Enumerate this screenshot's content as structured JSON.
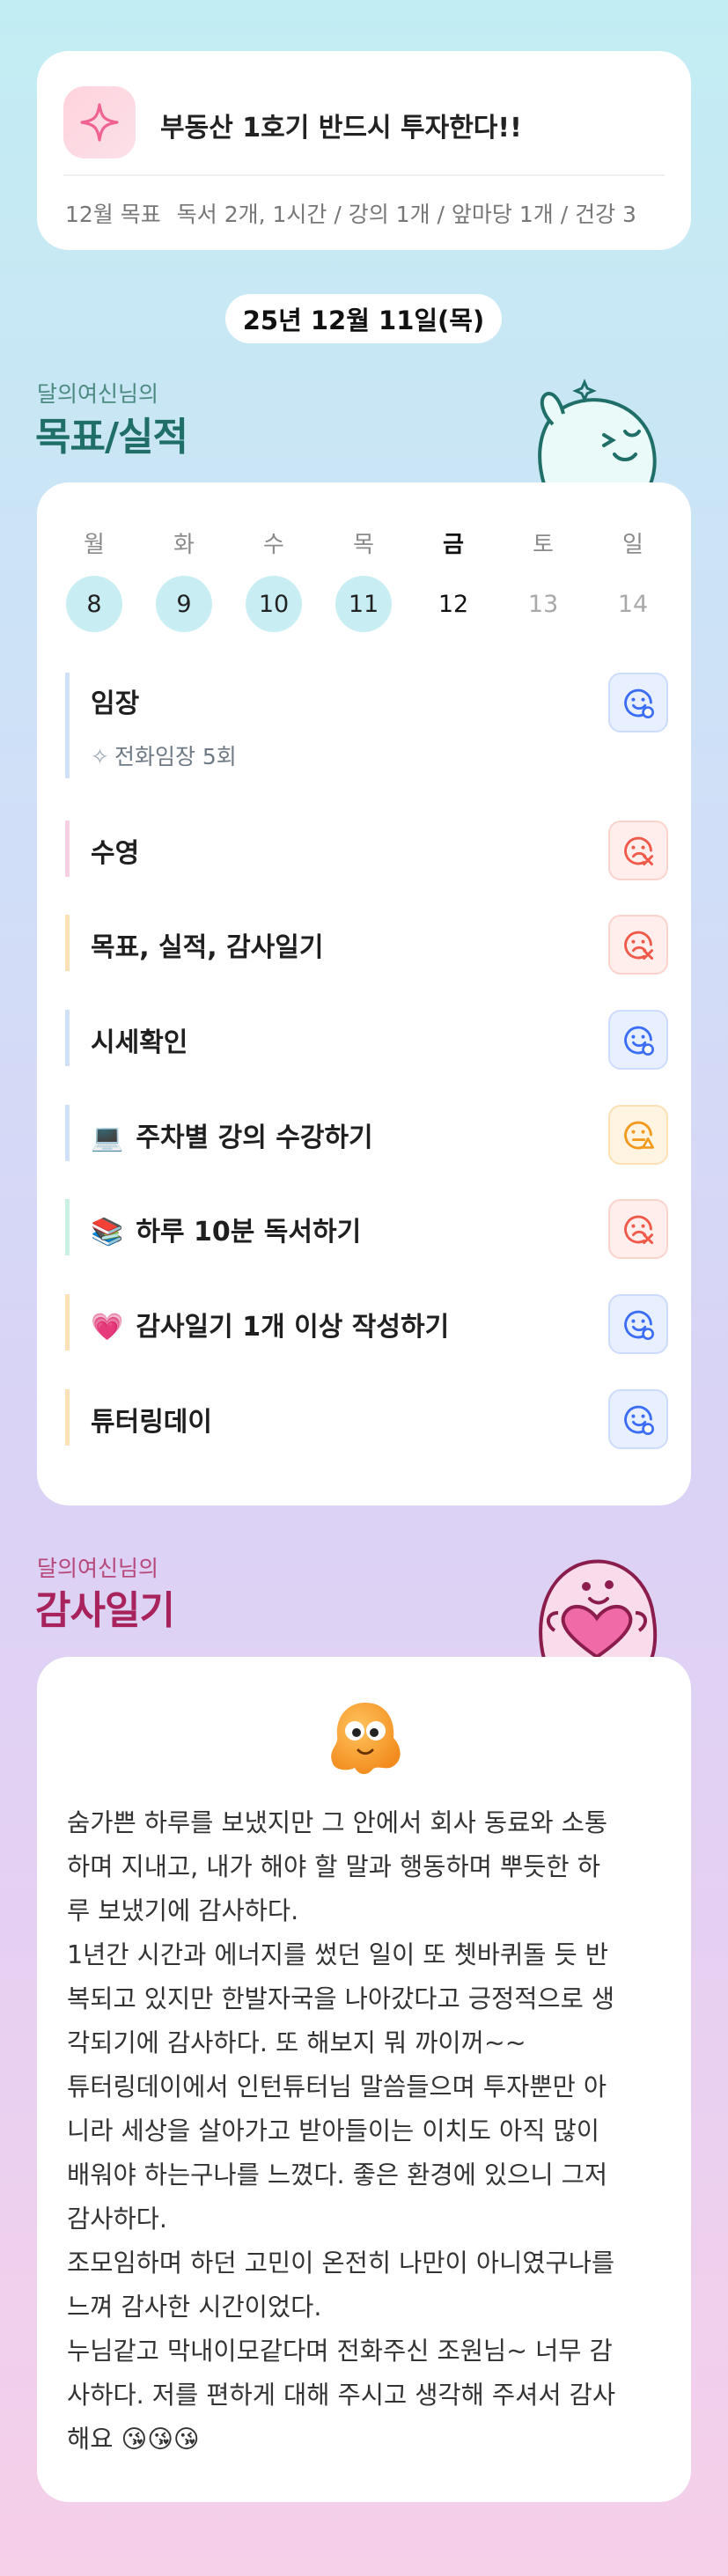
{
  "goal": {
    "title": "부동산 1호기 반드시 투자한다!!",
    "month_label": "12월 목표",
    "summary": "독서 2개, 1시간 / 강의 1개 / 앞마당 1개 / 건강 3"
  },
  "date": "25년 12월 11일(목)",
  "tasks_section": {
    "owner": "달의여신님의",
    "title": "목표/실적"
  },
  "week": [
    {
      "day": "월",
      "num": "8",
      "state": "done"
    },
    {
      "day": "화",
      "num": "9",
      "state": "done"
    },
    {
      "day": "수",
      "num": "10",
      "state": "done"
    },
    {
      "day": "목",
      "num": "11",
      "state": "done"
    },
    {
      "day": "금",
      "num": "12",
      "state": "today"
    },
    {
      "day": "토",
      "num": "13",
      "state": "future"
    },
    {
      "day": "일",
      "num": "14",
      "state": "future"
    }
  ],
  "tasks": [
    {
      "label": "임장",
      "sub": "전화임장 5회",
      "status": "ok",
      "color": "#cfe0f7"
    },
    {
      "label": "수영",
      "status": "bad",
      "color": "#f9cfe3"
    },
    {
      "label": "목표, 실적, 감사일기",
      "status": "bad",
      "color": "#fbe1b8"
    },
    {
      "label": "시세확인",
      "status": "ok",
      "color": "#cfe0f7"
    },
    {
      "label": "주차별 강의 수강하기",
      "emoji": "💻",
      "status": "warn",
      "color": "#cfe0f7"
    },
    {
      "label": "하루 10분 독서하기",
      "emoji": "📚",
      "status": "bad",
      "color": "#c9f0e2"
    },
    {
      "label": "감사일기 1개 이상 작성하기",
      "emoji": "💗",
      "status": "ok",
      "color": "#fbe1b8"
    },
    {
      "label": "튜터링데이",
      "status": "ok",
      "color": "#fbe1b8"
    }
  ],
  "status_colors": {
    "ok": "#3b6ef5",
    "bad": "#ef5a4a",
    "warn": "#f29a1d"
  },
  "gratitude_section": {
    "owner": "달의여신님의",
    "title": "감사일기"
  },
  "diary": {
    "text": "숨가쁜 하루를 보냈지만 그 안에서 회사 동료와 소통\n하며 지내고, 내가 해야 할 말과 행동하며 뿌듯한 하\n루 보냈기에 감사하다.\n1년간 시간과 에너지를 썼던 일이 또 쳇바퀴돌 듯 반\n복되고 있지만 한발자국을 나아갔다고 긍정적으로 생\n각되기에 감사하다. 또 해보지 뭐 까이꺼~~\n튜터링데이에서 인턴튜터님 말씀들으며 투자뿐만 아\n니라 세상을 살아가고 받아들이는 이치도 아직 많이\n배워야 하는구나를 느꼈다. 좋은 환경에 있으니 그저\n감사하다.\n조모임하며 하던 고민이 온전히 나만이 아니였구나를\n느껴 감사한 시간이었다.\n누님같고 막내이모같다며 전화주신 조원님~ 너무 감\n사하다. 저를 편하게 대해 주시고 생각해 주셔서 감사\n해요 😘😘😘"
  }
}
